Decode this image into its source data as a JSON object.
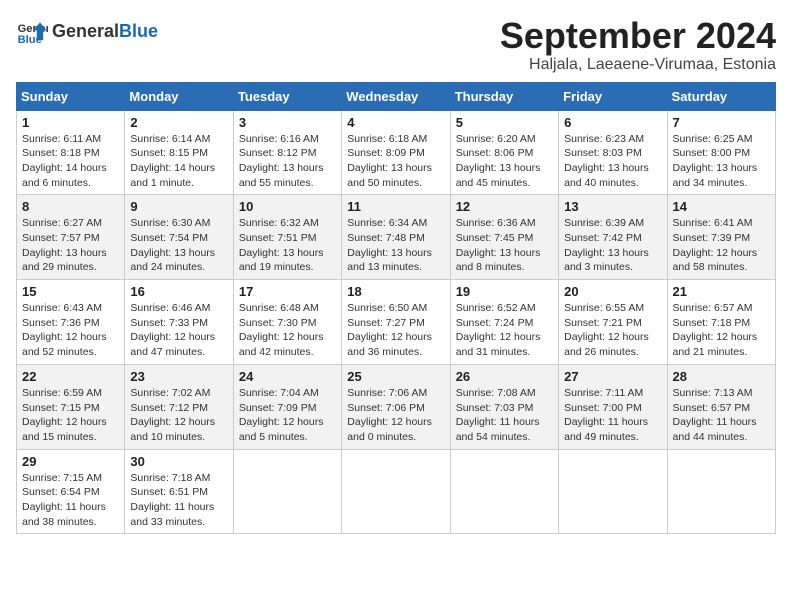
{
  "logo": {
    "text_general": "General",
    "text_blue": "Blue"
  },
  "header": {
    "month": "September 2024",
    "location": "Haljala, Laeaene-Virumaa, Estonia"
  },
  "weekdays": [
    "Sunday",
    "Monday",
    "Tuesday",
    "Wednesday",
    "Thursday",
    "Friday",
    "Saturday"
  ],
  "weeks": [
    [
      {
        "day": "1",
        "info": "Sunrise: 6:11 AM\nSunset: 8:18 PM\nDaylight: 14 hours\nand 6 minutes."
      },
      {
        "day": "2",
        "info": "Sunrise: 6:14 AM\nSunset: 8:15 PM\nDaylight: 14 hours\nand 1 minute."
      },
      {
        "day": "3",
        "info": "Sunrise: 6:16 AM\nSunset: 8:12 PM\nDaylight: 13 hours\nand 55 minutes."
      },
      {
        "day": "4",
        "info": "Sunrise: 6:18 AM\nSunset: 8:09 PM\nDaylight: 13 hours\nand 50 minutes."
      },
      {
        "day": "5",
        "info": "Sunrise: 6:20 AM\nSunset: 8:06 PM\nDaylight: 13 hours\nand 45 minutes."
      },
      {
        "day": "6",
        "info": "Sunrise: 6:23 AM\nSunset: 8:03 PM\nDaylight: 13 hours\nand 40 minutes."
      },
      {
        "day": "7",
        "info": "Sunrise: 6:25 AM\nSunset: 8:00 PM\nDaylight: 13 hours\nand 34 minutes."
      }
    ],
    [
      {
        "day": "8",
        "info": "Sunrise: 6:27 AM\nSunset: 7:57 PM\nDaylight: 13 hours\nand 29 minutes."
      },
      {
        "day": "9",
        "info": "Sunrise: 6:30 AM\nSunset: 7:54 PM\nDaylight: 13 hours\nand 24 minutes."
      },
      {
        "day": "10",
        "info": "Sunrise: 6:32 AM\nSunset: 7:51 PM\nDaylight: 13 hours\nand 19 minutes."
      },
      {
        "day": "11",
        "info": "Sunrise: 6:34 AM\nSunset: 7:48 PM\nDaylight: 13 hours\nand 13 minutes."
      },
      {
        "day": "12",
        "info": "Sunrise: 6:36 AM\nSunset: 7:45 PM\nDaylight: 13 hours\nand 8 minutes."
      },
      {
        "day": "13",
        "info": "Sunrise: 6:39 AM\nSunset: 7:42 PM\nDaylight: 13 hours\nand 3 minutes."
      },
      {
        "day": "14",
        "info": "Sunrise: 6:41 AM\nSunset: 7:39 PM\nDaylight: 12 hours\nand 58 minutes."
      }
    ],
    [
      {
        "day": "15",
        "info": "Sunrise: 6:43 AM\nSunset: 7:36 PM\nDaylight: 12 hours\nand 52 minutes."
      },
      {
        "day": "16",
        "info": "Sunrise: 6:46 AM\nSunset: 7:33 PM\nDaylight: 12 hours\nand 47 minutes."
      },
      {
        "day": "17",
        "info": "Sunrise: 6:48 AM\nSunset: 7:30 PM\nDaylight: 12 hours\nand 42 minutes."
      },
      {
        "day": "18",
        "info": "Sunrise: 6:50 AM\nSunset: 7:27 PM\nDaylight: 12 hours\nand 36 minutes."
      },
      {
        "day": "19",
        "info": "Sunrise: 6:52 AM\nSunset: 7:24 PM\nDaylight: 12 hours\nand 31 minutes."
      },
      {
        "day": "20",
        "info": "Sunrise: 6:55 AM\nSunset: 7:21 PM\nDaylight: 12 hours\nand 26 minutes."
      },
      {
        "day": "21",
        "info": "Sunrise: 6:57 AM\nSunset: 7:18 PM\nDaylight: 12 hours\nand 21 minutes."
      }
    ],
    [
      {
        "day": "22",
        "info": "Sunrise: 6:59 AM\nSunset: 7:15 PM\nDaylight: 12 hours\nand 15 minutes."
      },
      {
        "day": "23",
        "info": "Sunrise: 7:02 AM\nSunset: 7:12 PM\nDaylight: 12 hours\nand 10 minutes."
      },
      {
        "day": "24",
        "info": "Sunrise: 7:04 AM\nSunset: 7:09 PM\nDaylight: 12 hours\nand 5 minutes."
      },
      {
        "day": "25",
        "info": "Sunrise: 7:06 AM\nSunset: 7:06 PM\nDaylight: 12 hours\nand 0 minutes."
      },
      {
        "day": "26",
        "info": "Sunrise: 7:08 AM\nSunset: 7:03 PM\nDaylight: 11 hours\nand 54 minutes."
      },
      {
        "day": "27",
        "info": "Sunrise: 7:11 AM\nSunset: 7:00 PM\nDaylight: 11 hours\nand 49 minutes."
      },
      {
        "day": "28",
        "info": "Sunrise: 7:13 AM\nSunset: 6:57 PM\nDaylight: 11 hours\nand 44 minutes."
      }
    ],
    [
      {
        "day": "29",
        "info": "Sunrise: 7:15 AM\nSunset: 6:54 PM\nDaylight: 11 hours\nand 38 minutes."
      },
      {
        "day": "30",
        "info": "Sunrise: 7:18 AM\nSunset: 6:51 PM\nDaylight: 11 hours\nand 33 minutes."
      },
      {
        "day": "",
        "info": ""
      },
      {
        "day": "",
        "info": ""
      },
      {
        "day": "",
        "info": ""
      },
      {
        "day": "",
        "info": ""
      },
      {
        "day": "",
        "info": ""
      }
    ]
  ]
}
